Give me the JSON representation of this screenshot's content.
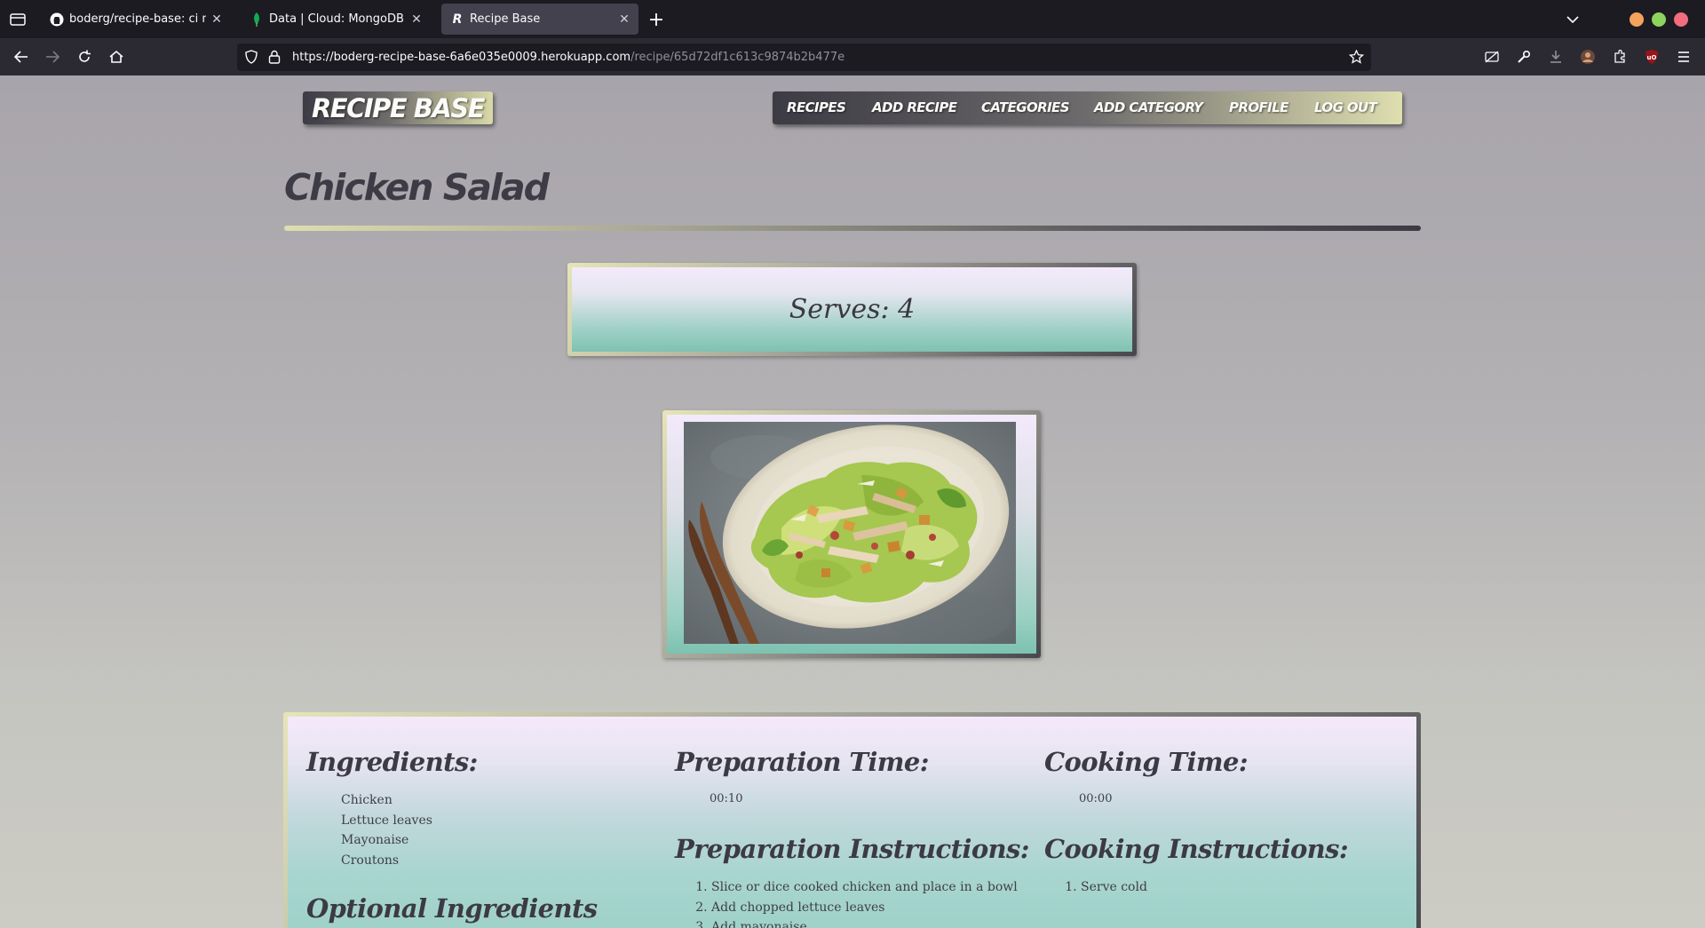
{
  "browser": {
    "tabs": [
      {
        "title": "boderg/recipe-base: ci milestone",
        "icon": "github-icon",
        "active": false
      },
      {
        "title": "Data | Cloud: MongoDB Cloud",
        "icon": "mongodb-leaf-icon",
        "active": false
      },
      {
        "title": "Recipe Base",
        "icon": "recipe-base-favicon",
        "active": true
      }
    ],
    "url_host": "https://boderg-recipe-base-6a6e035e0009.herokuapp.com",
    "url_path": "/recipe/65d72df1c613c9874b2b477e",
    "favicon_letter": "R"
  },
  "site": {
    "brand": "RECIPE BASE",
    "nav": [
      "RECIPES",
      "ADD RECIPE",
      "CATEGORIES",
      "ADD CATEGORY",
      "PROFILE",
      "LOG OUT"
    ]
  },
  "recipe": {
    "title": "Chicken Salad",
    "serves": "Serves: 4",
    "ingredients_heading": "Ingredients:",
    "ingredients": [
      "Chicken",
      "Lettuce leaves",
      "Mayonaise",
      "Croutons"
    ],
    "optional_heading": "Optional Ingredients",
    "prep_time_heading": "Preparation Time:",
    "prep_time": "00:10",
    "cook_time_heading": "Cooking Time:",
    "cook_time": "00:00",
    "prep_instructions_heading": "Preparation Instructions:",
    "prep_instructions": [
      "Slice or dice cooked chicken and place in a bowl",
      "Add chopped lettuce leaves",
      "Add mayonaise"
    ],
    "cook_instructions_heading": "Cooking Instructions:",
    "cook_instructions": [
      "Serve cold"
    ]
  },
  "colors": {
    "page_bg_top": "#a8a4ab",
    "page_bg_bottom": "#ccccc4",
    "heading_text": "#3d3c46",
    "card_teal": "#7fc2b1",
    "card_lilac": "#f3eafb",
    "accent_gold": "#dedeb0"
  }
}
